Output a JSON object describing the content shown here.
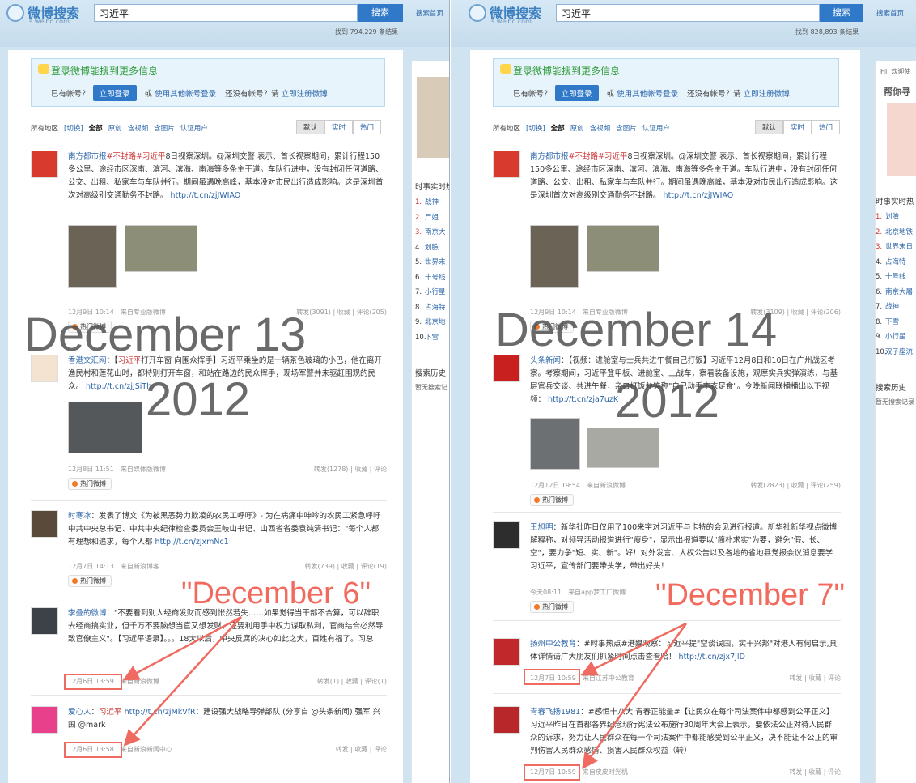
{
  "colors": {
    "accent": "#2f79c8",
    "keyword": "#cc3333",
    "annotation": "#f26a5e"
  },
  "common": {
    "logo_text": "微博搜索",
    "logo_sub": "s.weibo.com",
    "search_value": "习近平",
    "search_button": "搜索",
    "search_home": "搜索首页",
    "login_title": "登录微博能搜到更多信息",
    "have_account": "已有帐号？",
    "login_button": "立即登录",
    "or": "或",
    "other_login": "使用其他帐号登录",
    "no_account": "还没有帐号？请",
    "register": "立即注册微博",
    "filter_region": "所有地区",
    "filter_switch": "[切换]",
    "filter_all": "全部",
    "filter_orig": "原创",
    "filter_video": "含视频",
    "filter_pic": "含图片",
    "filter_verified": "认证用户",
    "sort_default": "默认",
    "sort_realtime": "实时",
    "sort_hot": "热门",
    "hot_label": "热门微博"
  },
  "left": {
    "result_count": "找到 794,229 条结果",
    "overlay_date": "December 13",
    "overlay_year": "2012",
    "annotation": "\"December 6\"",
    "posts": [
      {
        "text_nick": "南方都市报",
        "text_kw": "#不封路#习近平",
        "text": "8日视察深圳。@深圳交警 表示、首长视察期间，累计行程150多公里、途经市区深南、滨河、滨海、南海等多条主干道。车队行进中，没有封闭任何道路、公交、出租、私家车与车队并行。期间虽遇晚高峰，基本没对市民出行造成影响。这是深圳首次对高级别交通勤务不封路。",
        "link": "http://t.cn/zjJWIAO",
        "time": "12月9日 10:14",
        "from": "来自专业版微博",
        "acts": "转发(3091) | 收藏 | 评论(205)"
      },
      {
        "text_nick": "香港文汇网",
        "text_kw": "习近平",
        "text": "打开车窗 向围众挥手】习近平乘坐的是一辆茶色玻璃的小巴，他在离开渔民村和莲花山时，都特别打开车窗，和站在路边的民众挥手，现场军警并未驱赶围观的民众。",
        "link": "http://t.cn/zjJSiTh",
        "time": "12月8日 11:51",
        "from": "来自媒体版微博",
        "acts": "转发(1278) | 收藏 | 评论"
      },
      {
        "text_nick": "时寒冰",
        "text_kw": "习近平",
        "text": "：发表了博文《为被黑恶势力欺凌的农民工呼吁》- 为在病痛中呻吟的农民工紧急呼吁 中共中央总书记、中共中央纪律检查委员会王岐山书记、山西省省委袁纯清书记：\"每个人都有理想和追求，每个人都",
        "link": "http://t.cn/zjxmNc1",
        "time": "12月7日 14:13",
        "from": "来自新浪博客",
        "acts": "转发(739) | 收藏 | 评论(19)"
      },
      {
        "text_nick": "李叠的微博",
        "text_kw": "习近平",
        "text": "：\"不要看到别人经商发财而感到怅然若失……如果觉得当干部不合算，可以辞职去经商搞实业，但千万不要脑想当官又想发财，还要利用手中权力谋取私利，官商结合必然导致官僚主义\"。【习近平语录】。。。18大以后，中央反腐的决心如此之大，百姓有福了。习总",
        "link": "",
        "time": "12月6日 13:59",
        "from": "来自新浪微博",
        "acts": "转发(1) | 收藏 | 评论(1)"
      },
      {
        "text_nick": "爱心人",
        "text_kw": "习近平",
        "text": "：建设强大战略导弹部队 (分享自 @头条新闻) 强军 兴国 @mark",
        "link": "http://t.cn/zjMkVfR",
        "time": "12月6日 13:58",
        "from": "来自新浪新闻中心",
        "acts": "转发 | 收藏 | 评论"
      }
    ],
    "side_title": "时事实时热",
    "side_list": [
      "战神",
      "尸姐",
      "南京大",
      "划臉",
      "世界末",
      "十号线",
      "小行星",
      "占海特",
      "北京地",
      "下雪"
    ],
    "side_history": "搜索历史",
    "side_no_history": "暂无搜索记"
  },
  "right": {
    "result_count": "找到 828,893 条结果",
    "overlay_date": "December 14",
    "overlay_year": "2012",
    "annotation": "\"December 7\"",
    "posts": [
      {
        "text_nick": "南方都市报",
        "text_kw": "#不封路#习近平",
        "text": "8日视察深圳。@深圳交警 表示、首长视察期间，累计行程150多公里、途经市区深南、滨河、滨海、南海等多条主干道。车队行进中，没有封闭任何道路、公交、出租、私家车与车队并行。期间虽遇晚高峰，基本没对市民出行造成影响。这是深圳首次对高级别交通勤务不封路。",
        "link": "http://t.cn/zjJWIAO",
        "time": "12月9日 10:14",
        "from": "来自专业版微博",
        "acts": "转发(3109) | 收藏 | 评论(206)"
      },
      {
        "text_nick": "头条新闻",
        "text_kw": "习近平",
        "text": "：【视频：进舱室与士兵共进午餐自己打饭】习近平12月8日和10日在广州战区考察。考察期间，习近平登甲板、进舱室、上战车，察看装备设施，观摩实兵实弹演练，与基层官兵交谈、共进午餐，亲自打饭并笑称\"自己动手丰衣足食\"。今晚新闻联播播出以下视频：",
        "link": "http://t.cn/zja7uzK",
        "time": "12月12日 19:54",
        "from": "来自新浪微博",
        "acts": "转发(2823) | 收藏 | 评论(259)"
      },
      {
        "text_nick": "王旭明",
        "text_kw": "习近平",
        "text": "：新华社昨日仅用了100来字对习近平与卡特的会见进行报道。新华社新华视点微博解释称，对领导活动报道进行\"瘦身\"，显示出报道要以\"简朴求实\"为要，避免\"假、长、空\"，要力争\"短、实、新\"。好！对外发言、人权公告以及各地的省地县党报会议消息要学习近平，宣传部门要带头学，带出好头！",
        "link": "",
        "time": "今天08:11",
        "from": "来自app梦工厂微博",
        "acts": ""
      },
      {
        "text_nick": "扬州中公教育",
        "text_kw": "习近平",
        "text": "：#时事热点#港媒观察：习近平提\"空谈误国，实干兴邦\"对港人有何启示,具体详情请广大朋友们抓紧时间点击查看哈！",
        "link": "http://t.cn/zjx7JlD",
        "time": "12月7日 10:59",
        "from": "来自江苏中公教育",
        "acts": "转发 | 收藏 | 评论"
      },
      {
        "text_nick": "青春飞扬1981",
        "text_kw": "习近平",
        "text": "：#感恒十八大·青春正能量#【让民众在每个司法案件中都感到公平正义】习近平昨日在首都各界纪念现行宪法公布施行30周年大会上表示，要依法公正对待人民群众的诉求，努力让人民群众在每一个司法案件中都能感受到公平正义，决不能让不公正的审判伤害人民群众感情、损害人民群众权益（转）",
        "link": "",
        "time": "12月7日 10:59",
        "from": "来自皮皮时光机",
        "acts": "转发 | 收藏 | 评论"
      }
    ],
    "side_top": "Hi, 欢迎使",
    "side_help": "帮你寻",
    "side_title": "时事实时热",
    "side_list": [
      "划臉",
      "北京地铁",
      "世界末日",
      "占海特",
      "十号线",
      "南京大屠",
      "战神",
      "下雪",
      "小行星",
      "双子座流"
    ],
    "side_history": "搜索历史",
    "side_no_history": "暂无搜索记录"
  }
}
